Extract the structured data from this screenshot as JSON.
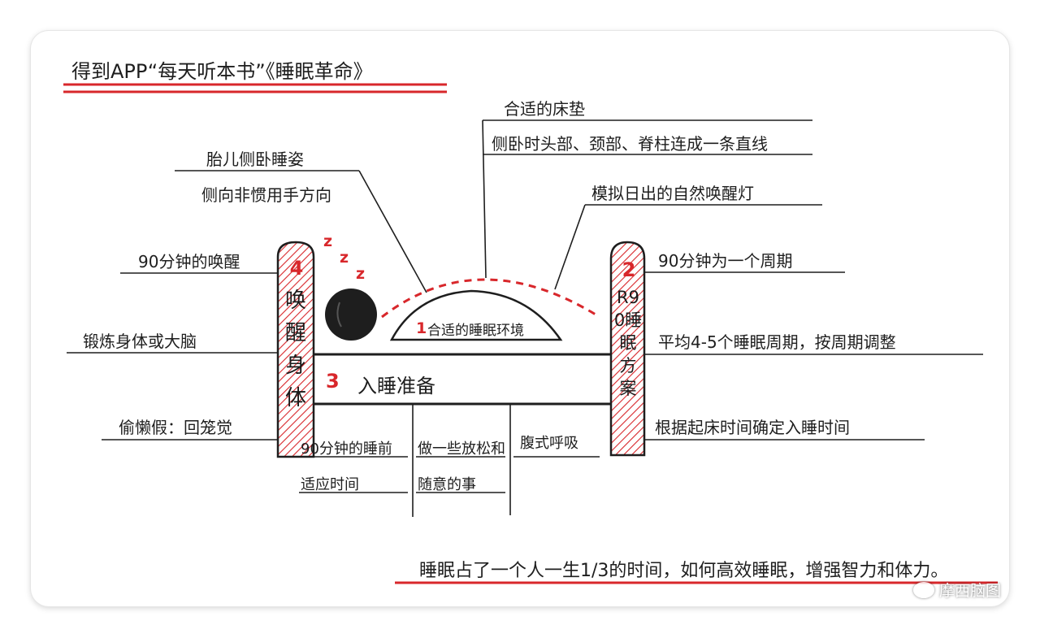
{
  "title": "得到APP“每天听本书”《睡眠革命》",
  "nodes": {
    "center": {
      "num": "1",
      "label": "合适的睡眠环境"
    },
    "r90": {
      "num": "2",
      "label": "R90睡眠方案"
    },
    "prep": {
      "num": "3",
      "label": "入睡准备"
    },
    "wake": {
      "num": "4",
      "label": "唤醒身体"
    }
  },
  "zzz": [
    "z",
    "z",
    "z"
  ],
  "env_branches": {
    "mattress_title": "合适的床垫",
    "mattress_detail": "侧卧时头部、颈部、脊柱连成一条直线",
    "fetal_title": "胎儿侧卧睡姿",
    "fetal_detail": "侧向非惯用手方向",
    "sunrise_lamp": "模拟日出的自然唤醒灯"
  },
  "r90_branches": [
    "90分钟为一个周期",
    "平均4-5个睡眠周期，按周期调整",
    "根据起床时间确定入睡时间"
  ],
  "wake_branches": [
    "90分钟的唤醒",
    "锻炼身体或大脑",
    "偷懒假：回笼觉"
  ],
  "prep_branches": [
    "90分钟的睡前适应时间",
    "做一些放松和随意的事",
    "腹式呼吸"
  ],
  "summary": "睡眠占了一个人一生1/3的时间，如何高效睡眠，增强智力和体力。",
  "watermark": "摩西脑图",
  "colors": {
    "accent": "#d8272b",
    "ink": "#1e1e1e"
  }
}
